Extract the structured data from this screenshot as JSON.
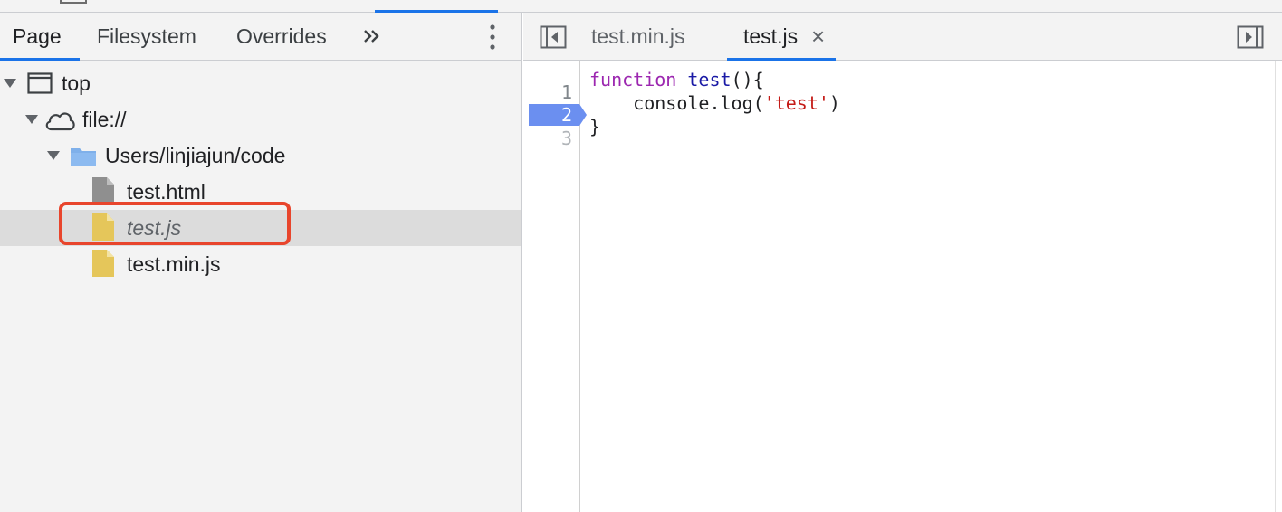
{
  "navigator": {
    "tabs": [
      {
        "label": "Page",
        "active": true
      },
      {
        "label": "Filesystem",
        "active": false
      },
      {
        "label": "Overrides",
        "active": false
      }
    ],
    "more_tabs_icon": "double-chevron-right-icon",
    "menu_icon": "kebab-menu-icon",
    "tree": [
      {
        "label": "top",
        "icon": "frame-icon",
        "expanded": true,
        "depth": 0
      },
      {
        "label": "file://",
        "icon": "cloud-icon",
        "expanded": true,
        "depth": 1
      },
      {
        "label": "Users/linjiajun/code",
        "icon": "folder-icon",
        "expanded": true,
        "depth": 2
      },
      {
        "label": "test.html",
        "icon": "file-icon",
        "depth": 3
      },
      {
        "label": "test.js",
        "icon": "js-file-icon",
        "depth": 3,
        "selected": true,
        "italic": true
      },
      {
        "label": "test.min.js",
        "icon": "js-file-icon",
        "depth": 3
      }
    ]
  },
  "editor": {
    "tabs": [
      {
        "label": "test.min.js",
        "active": false
      },
      {
        "label": "test.js",
        "active": true,
        "closable": true
      }
    ],
    "close_glyph": "×",
    "line_numbers": [
      "1",
      "2",
      "3"
    ],
    "breakpoint_line": 2,
    "code": {
      "line1": {
        "kw": "function",
        "fn": "test",
        "rest": "(){"
      },
      "line2": {
        "pre": "    console.log(",
        "str": "'test'",
        "post": ")"
      },
      "line3": "}"
    }
  },
  "colors": {
    "accent": "#1a73e8",
    "highlight": "#e8452c",
    "breakpoint": "#6b8ff0",
    "folder": "#7fb0ea",
    "js_file": "#e5c65a",
    "html_file": "#8f8f8f"
  }
}
